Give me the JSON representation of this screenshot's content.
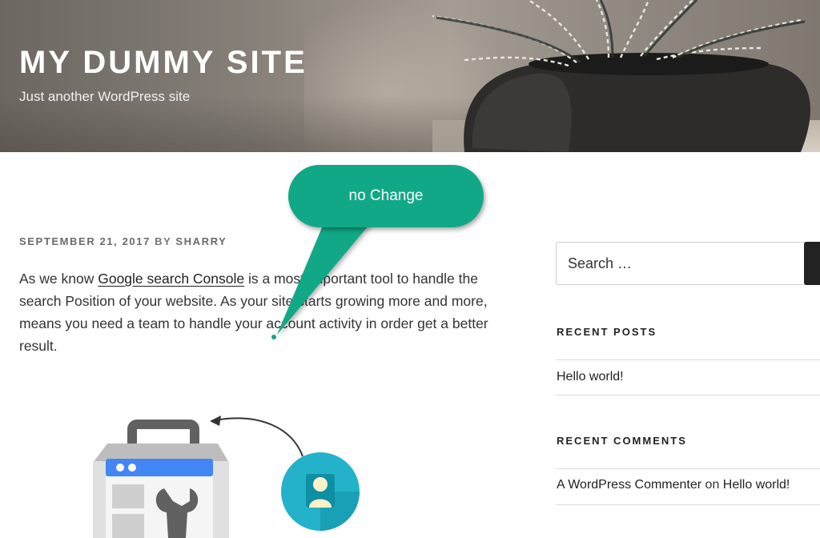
{
  "header": {
    "site_title": "MY DUMMY SITE",
    "tagline": "Just another WordPress site"
  },
  "post": {
    "meta_date": "SEPTEMBER 21, 2017",
    "meta_by": "BY",
    "meta_author": "SHARRY",
    "body_before_link": "As we know ",
    "body_link": "Google search Console",
    "body_after_link": " is a most important tool to handle the search Position of your website. As your site starts growing more and more, means you need a team to handle your account activity in order get a better result."
  },
  "callout": {
    "text": "no Change",
    "color": "#11a887"
  },
  "sidebar": {
    "search": {
      "placeholder": "Search …"
    },
    "recent_posts": {
      "title": "RECENT POSTS",
      "items": [
        {
          "label": "Hello world!"
        }
      ]
    },
    "recent_comments": {
      "title": "RECENT COMMENTS",
      "items": [
        {
          "author": "A WordPress Commenter",
          "connector": " on ",
          "post": "Hello world!"
        }
      ]
    }
  },
  "illustration": {
    "icons": [
      "toolbox-icon",
      "wrench-icon",
      "curved-arrow-icon",
      "user-avatar-icon"
    ]
  }
}
